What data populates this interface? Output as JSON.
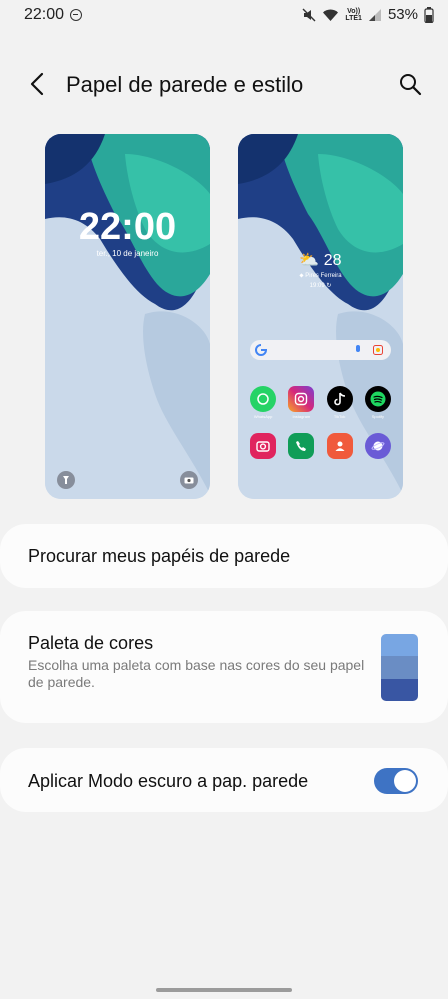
{
  "status_bar": {
    "time": "22:00",
    "battery": "53%",
    "network_top": "Vo))",
    "network_bottom": "LTE1"
  },
  "header": {
    "title": "Papel de parede e estilo"
  },
  "lock_preview": {
    "time": "22:00",
    "date": "ter., 10 de janeiro"
  },
  "home_preview": {
    "temperature": "28",
    "location": "Pires Ferreira",
    "time": "19:09",
    "apps": [
      {
        "label": "WhatsApp",
        "color": "#25d366"
      },
      {
        "label": "Instagram",
        "color": "#d6287a"
      },
      {
        "label": "TikTok",
        "color": "#000000"
      },
      {
        "label": "Spotify",
        "color": "#000000"
      },
      {
        "label": "",
        "color": "#e0245e"
      },
      {
        "label": "",
        "color": "#109d58"
      },
      {
        "label": "",
        "color": "#f05a3c"
      },
      {
        "label": "",
        "color": "#6a5bd6"
      }
    ]
  },
  "cards": {
    "browse": {
      "title": "Procurar meus papéis de parede"
    },
    "palette": {
      "title": "Paleta de cores",
      "description": "Escolha uma paleta com base nas cores do seu papel de parede.",
      "colors": [
        "#78a6e3",
        "#6a8dc4",
        "#3956a3"
      ]
    },
    "dark_mode": {
      "title": "Aplicar Modo escuro a pap. parede",
      "enabled": true
    }
  },
  "colors": {
    "background": "#f2f2f2",
    "card": "#fcfcfc",
    "accent": "#3e73c4"
  }
}
